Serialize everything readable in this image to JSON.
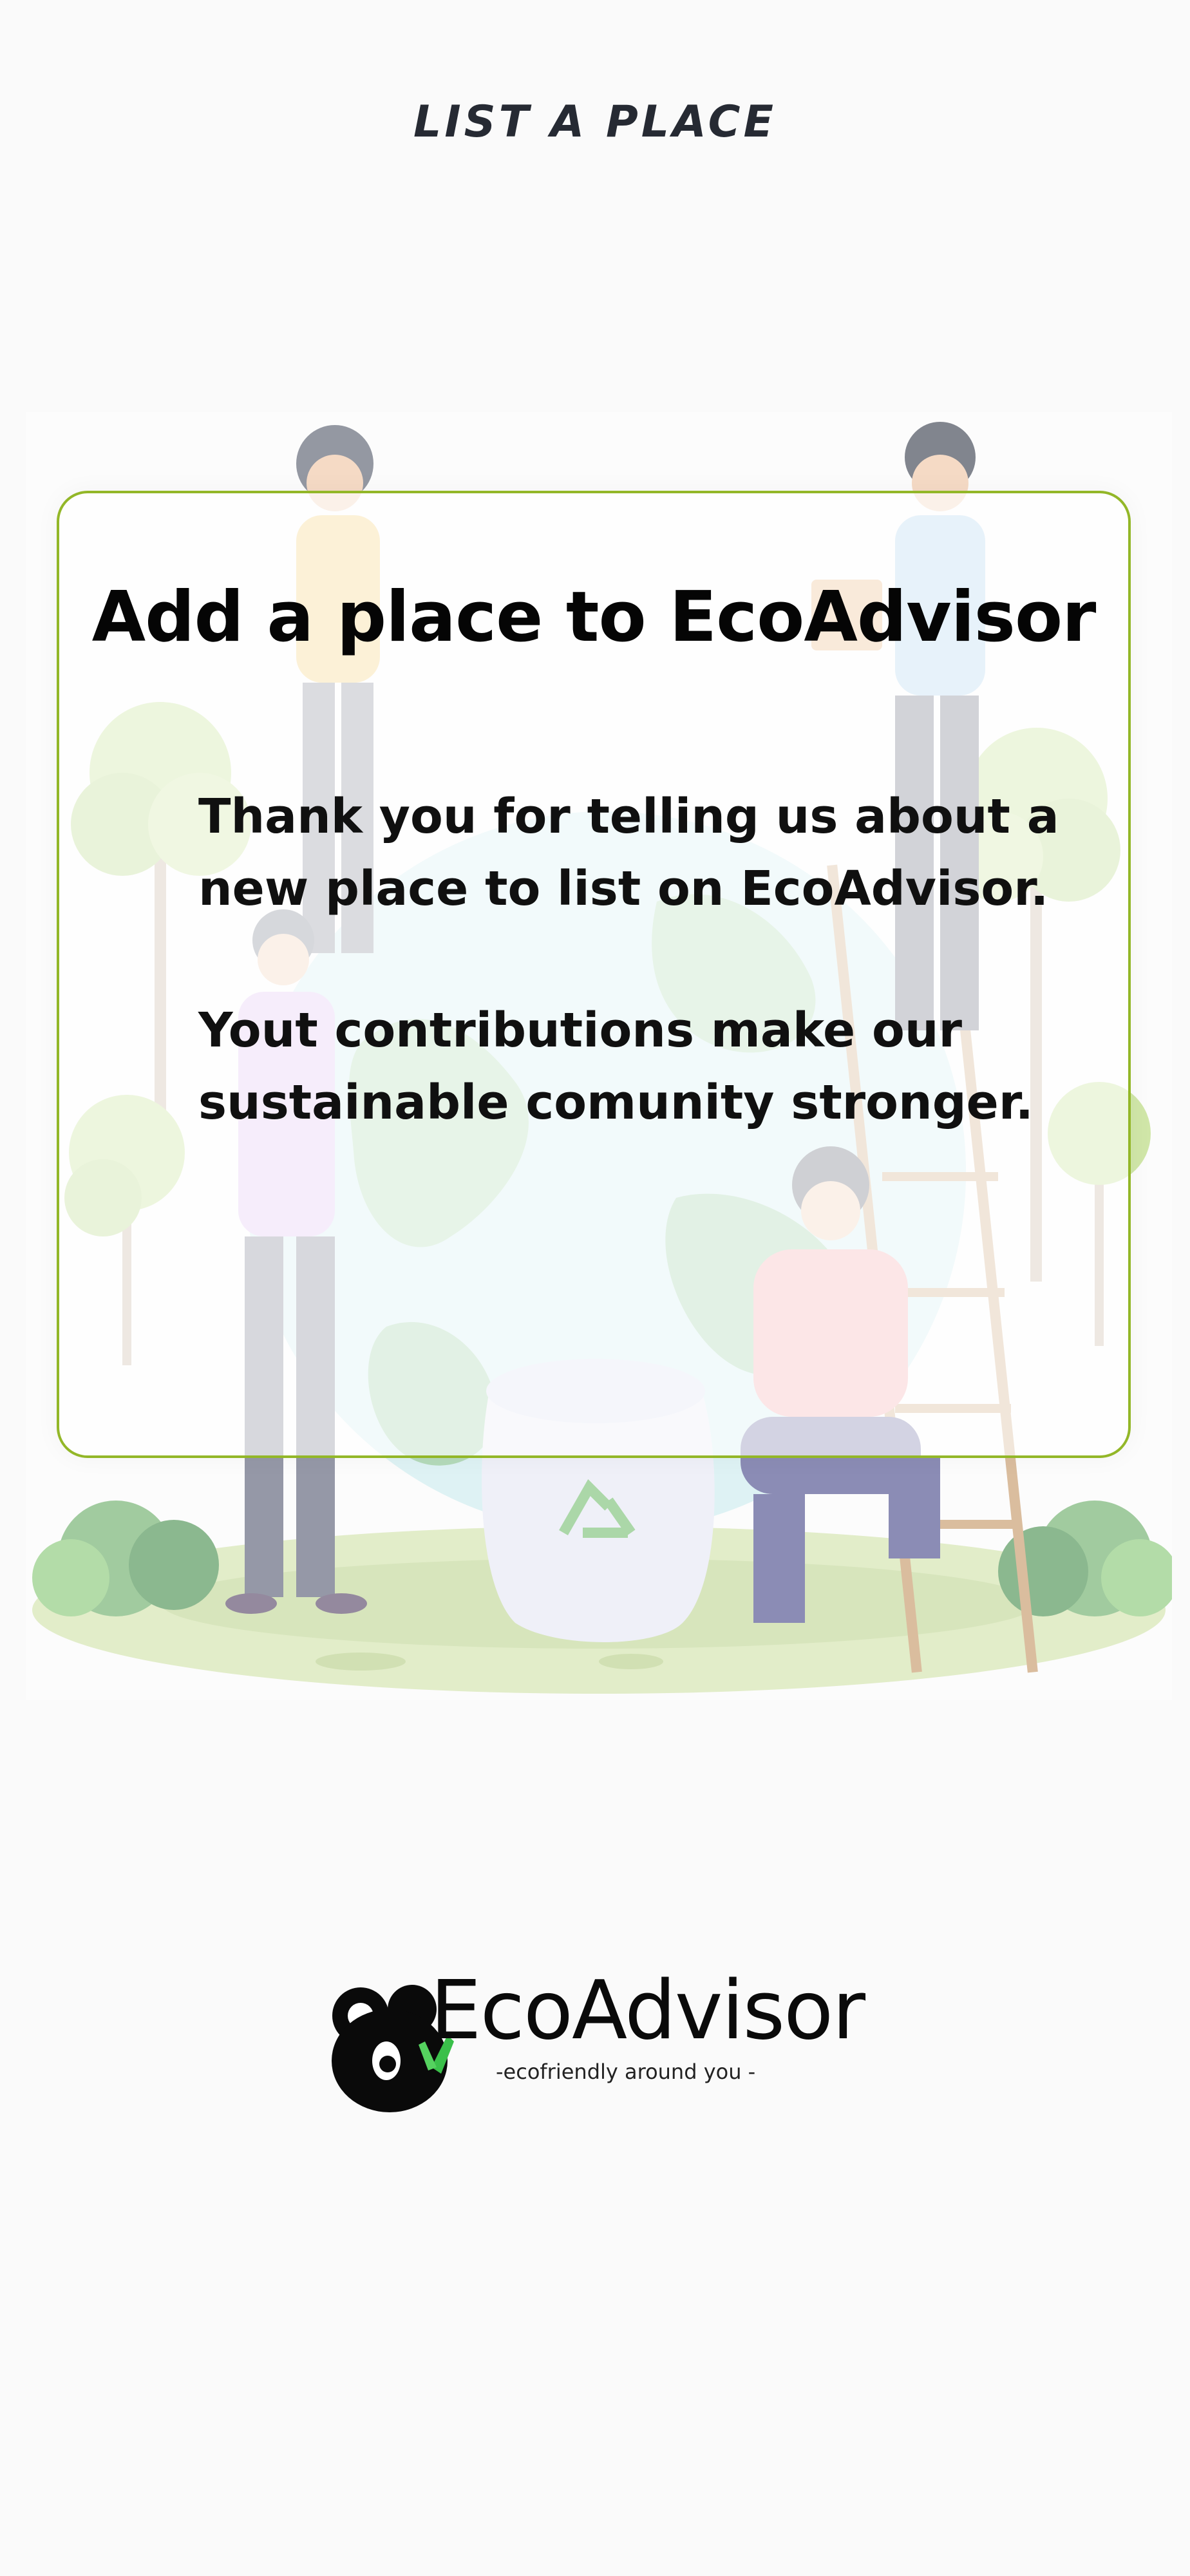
{
  "header": {
    "title": "LIST A PLACE"
  },
  "card": {
    "title": "Add a place to EcoAdvisor",
    "paragraph_1": "Thank you for telling us about a new place to list on EcoAdvisor.",
    "paragraph_2": "Yout contributions make our sustainable comunity stronger."
  },
  "brand": {
    "name": "EcoAdvisor",
    "tagline": "-ecofriendly around you  -"
  },
  "colors": {
    "background": "#fafafa",
    "card_border": "#93b728",
    "title_text": "#262a33",
    "body_text": "#050505"
  },
  "icons": {
    "illustration": "people-planting-around-globe-illustration",
    "logo": "koala-logo-icon",
    "recycle": "recycle-icon"
  }
}
